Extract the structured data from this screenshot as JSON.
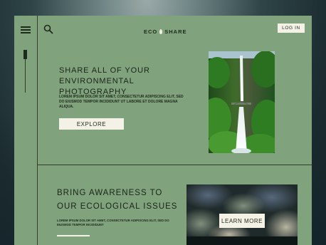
{
  "header": {
    "logo_left": "ECO",
    "logo_right": "SHARE",
    "login_label": "LOG IN"
  },
  "hero": {
    "title": "SHARE ALL OF YOUR ENVIRONMENTAL PHOTOGRAPHY",
    "body": "LOREM IPSUM DOLOR SIT AMET, CONSECTETUR ADIPISCING ELIT, SED DO EIUSMOD TEMPOR INCIDIDUNT UT LABORE ET DOLORE MAGNA ALIQUA.",
    "button_label": "EXPLORE"
  },
  "section2": {
    "title": "BRING AWARENESS TO OUR ECOLOGICAL ISSUES",
    "body": "LOREM IPSUM DOLOR SIT AMET, CONSECTETUR ADIPISCING ELIT, SED DO EIUSMOD TEMPOR INCIDIDUNT",
    "button_label": "LEARN MORE"
  },
  "colors": {
    "page_background": "#80a27c",
    "button_background": "#f4f1e6",
    "text": "#1a2519"
  },
  "icons": [
    "menu-icon",
    "search-icon",
    "leaf-icon"
  ]
}
